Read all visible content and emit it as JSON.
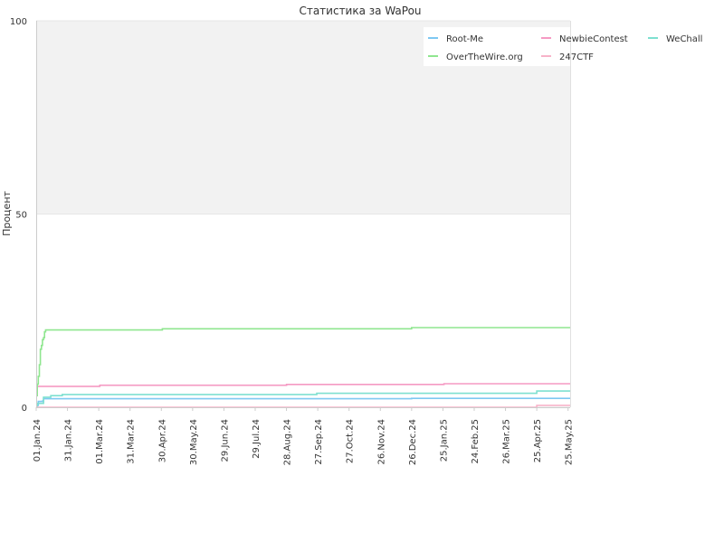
{
  "chart_data": {
    "type": "line",
    "title": "Статистика за WaPou",
    "ylabel": "Процент",
    "xlabel": "",
    "ylim": [
      0,
      100
    ],
    "yticks": [
      0,
      50,
      100
    ],
    "xlim": [
      "2024-01-01",
      "2025-05-27"
    ],
    "xtick_labels": [
      "01.Jan.24",
      "31.Jan.24",
      "01.Mar.24",
      "31.Mar.24",
      "30.Apr.24",
      "30.May.24",
      "29.Jun.24",
      "29.Jul.24",
      "28.Aug.24",
      "27.Sep.24",
      "27.Oct.24",
      "26.Nov.24",
      "26.Dec.24",
      "25.Jan.25",
      "24.Feb.25",
      "26.Mar.25",
      "25.Apr.25",
      "25.May.25"
    ],
    "xtick_dates": [
      "2024-01-01",
      "2024-01-31",
      "2024-03-01",
      "2024-03-31",
      "2024-04-30",
      "2024-05-30",
      "2024-06-29",
      "2024-07-29",
      "2024-08-28",
      "2024-09-27",
      "2024-10-27",
      "2024-11-26",
      "2024-12-26",
      "2025-01-25",
      "2025-02-24",
      "2025-03-26",
      "2025-04-25",
      "2025-05-25"
    ],
    "grid": true,
    "background_bands": [
      {
        "from": 50,
        "to": 100,
        "color": "#f2f2f2"
      }
    ],
    "legend": {
      "placement": "top-right",
      "columns": 3
    },
    "series": [
      {
        "name": "Root-Me",
        "color": "#7ec8f2",
        "x": [
          "2024-01-01",
          "2024-01-02",
          "2024-01-03",
          "2024-01-07",
          "2024-01-08",
          "2024-12-26",
          "2025-04-25",
          "2025-05-27"
        ],
        "y": [
          0,
          0.5,
          1.5,
          1.6,
          2.2,
          2.3,
          2.3,
          2.3
        ]
      },
      {
        "name": "NewbieContest",
        "color": "#f59ac3",
        "x": [
          "2024-01-01",
          "2024-01-02",
          "2024-03-01",
          "2024-03-02",
          "2024-08-27",
          "2024-08-28",
          "2025-01-25",
          "2025-01-26",
          "2025-05-27"
        ],
        "y": [
          5.2,
          5.4,
          5.4,
          5.7,
          5.7,
          5.9,
          5.9,
          6.1,
          6.1
        ]
      },
      {
        "name": "WeChall",
        "color": "#7ee0d0",
        "x": [
          "2024-01-01",
          "2024-01-02",
          "2024-01-07",
          "2024-01-08",
          "2024-01-14",
          "2024-01-15",
          "2024-01-25",
          "2024-01-26",
          "2024-09-25",
          "2024-09-26",
          "2025-04-24",
          "2025-04-25",
          "2025-05-27"
        ],
        "y": [
          0,
          1,
          1,
          2.6,
          2.6,
          3.0,
          3.0,
          3.3,
          3.3,
          3.6,
          3.6,
          4.2,
          4.2
        ]
      },
      {
        "name": "OverTheWire.org",
        "color": "#8fe68f",
        "x": [
          "2024-01-01",
          "2024-01-02",
          "2024-01-03",
          "2024-01-04",
          "2024-01-05",
          "2024-01-06",
          "2024-01-07",
          "2024-01-08",
          "2024-01-09",
          "2024-01-10",
          "2024-04-30",
          "2024-05-01",
          "2024-12-25",
          "2024-12-26",
          "2025-05-27"
        ],
        "y": [
          3,
          6,
          8,
          11,
          15,
          16,
          17.5,
          18,
          19.5,
          20,
          20,
          20.3,
          20.3,
          20.6,
          20.6
        ]
      },
      {
        "name": "247CTF",
        "color": "#f7b3c9",
        "x": [
          "2024-01-01",
          "2025-04-24",
          "2025-04-25",
          "2025-05-27"
        ],
        "y": [
          0,
          0,
          0.5,
          0.5
        ]
      }
    ]
  }
}
